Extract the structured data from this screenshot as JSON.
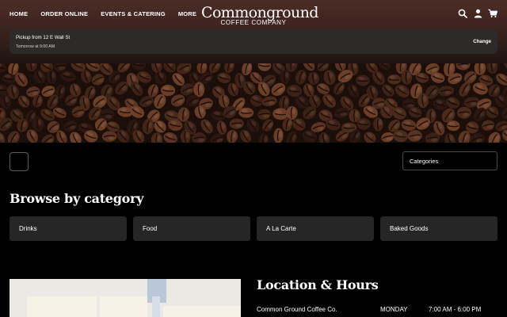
{
  "header": {
    "nav": [
      "HOME",
      "ORDER ONLINE",
      "EVENTS & CATERING",
      "MORE"
    ],
    "logo_main": "Commonground",
    "logo_sub": "COFFEE COMPANY",
    "icons": [
      "search-icon",
      "user-icon",
      "cart-icon"
    ]
  },
  "pickup": {
    "location": "Pickup from 12 E Wall St",
    "time": "Tomorrow at 9:00 AM",
    "change_label": "Change"
  },
  "filters": {
    "categories_label": "Categories"
  },
  "browse": {
    "title": "Browse by category",
    "categories": [
      "Drinks",
      "Food",
      "A La Carte",
      "Baked Goods"
    ]
  },
  "location": {
    "title": "Location & Hours",
    "name": "Common Ground Coffee Co.",
    "day": "MONDAY",
    "hours": "7:00 AM - 6:00 PM"
  },
  "colors": {
    "header_top": "#4a2d26",
    "card_bg": "#262626",
    "pickup_bg": "#2e2a29"
  }
}
